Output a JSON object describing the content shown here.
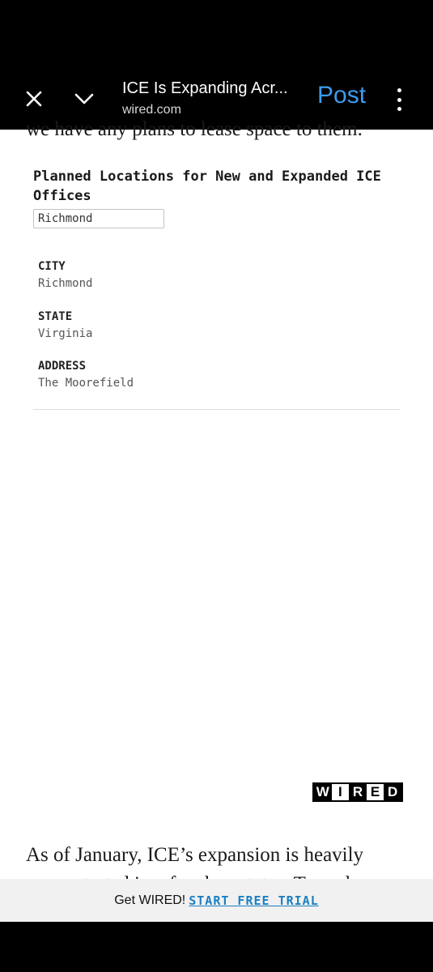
{
  "header": {
    "title": "ICE Is Expanding Acr...",
    "domain": "wired.com",
    "post_label": "Post",
    "close_icon": "close-icon",
    "chevron_icon": "chevron-down-icon",
    "more_icon": "more-vertical-icon"
  },
  "article": {
    "clipped_text": "we have any plans to lease space to them.",
    "paragraph_lines": [
      "As of January, ICE’s expansion is heavily",
      "concentrated in a few key states. Texas has"
    ]
  },
  "graphic": {
    "title": "Planned Locations for New and Expanded ICE Offices",
    "search_value": "Richmond",
    "fields": [
      {
        "label": "CITY",
        "value": "Richmond"
      },
      {
        "label": "STATE",
        "value": "Virginia"
      },
      {
        "label": "ADDRESS",
        "value": "The Moorefield"
      }
    ],
    "logo_text": "WIRED"
  },
  "promo": {
    "text": "Get WIRED!",
    "cta": "START FREE TRIAL",
    "cta_color": "#1a7fc4"
  },
  "colors": {
    "post_blue": "#3b9cf0",
    "bar_background": "#000000"
  }
}
